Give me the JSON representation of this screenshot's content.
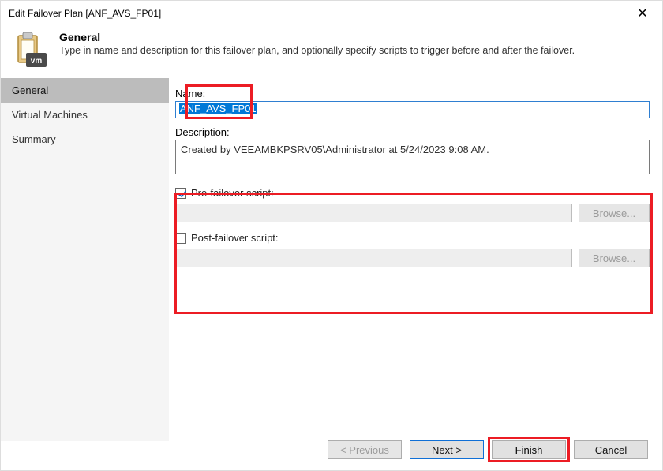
{
  "window": {
    "title": "Edit Failover Plan [ANF_AVS_FP01]"
  },
  "header": {
    "heading": "General",
    "subheading": "Type in name and description for this failover plan, and optionally specify scripts to trigger before and after the failover."
  },
  "sidebar": {
    "items": [
      {
        "label": "General",
        "selected": true
      },
      {
        "label": "Virtual Machines",
        "selected": false
      },
      {
        "label": "Summary",
        "selected": false
      }
    ]
  },
  "form": {
    "name_label": "Name:",
    "name_value": "ANF_AVS_FP01",
    "description_label": "Description:",
    "description_value": "Created by VEEAMBKPSRV05\\Administrator at 5/24/2023 9:08 AM.",
    "pre_script_checked": true,
    "pre_script_label": "Pre-failover script:",
    "pre_script_path": "",
    "post_script_checked": false,
    "post_script_label": "Post-failover script:",
    "post_script_path": "",
    "browse_label": "Browse..."
  },
  "footer": {
    "previous": "< Previous",
    "next": "Next >",
    "finish": "Finish",
    "cancel": "Cancel"
  }
}
